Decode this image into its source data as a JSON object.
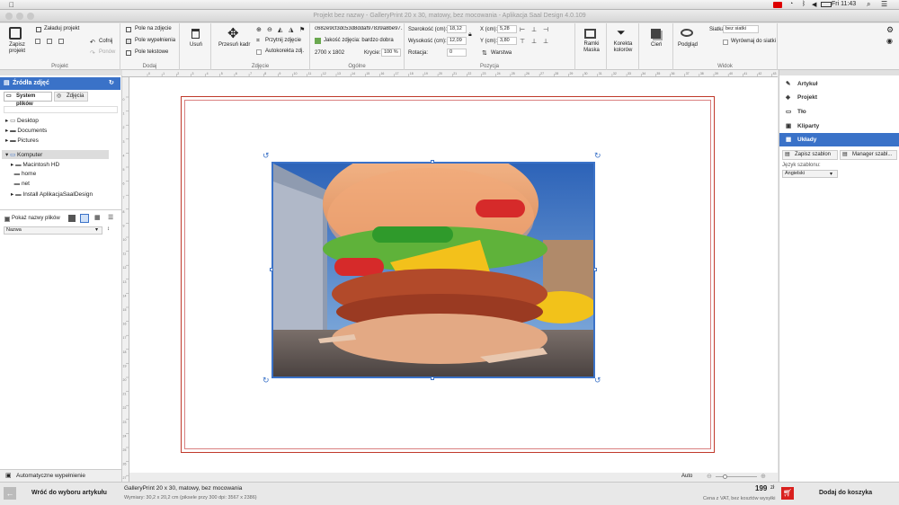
{
  "menubar": {
    "clock": "Fri 11:43"
  },
  "window": {
    "title": "Projekt bez nazwy - GalleryPrint 20 x 30, matowy, bez mocowania - Aplikacja Saal Design 4.0.109"
  },
  "ribbon": {
    "projekt": {
      "group_label": "Projekt",
      "save": "Zapisz projekt",
      "load": "Załaduj projekt",
      "undo": "Cofnij",
      "redo": "Ponów"
    },
    "dodaj": {
      "group_label": "Dodaj",
      "photo_field": "Pole na zdjęcie",
      "fill_field": "Pole wypełnienia",
      "text_field": "Pole tekstowe"
    },
    "usun": {
      "label": "Usuń"
    },
    "zdjecie": {
      "group_label": "Zdjęcie",
      "move_crop": "Przesuń kadr",
      "crop": "Przytnij zdjęcie",
      "autocorrect": "Autokorekta zdj."
    },
    "ogolne": {
      "group_label": "Ogólne",
      "filename": "c682e9cf3dc53d8ddaf97839a8be97...",
      "quality": "Jakość zdjęcia: bardzo dobra",
      "resolution": "2700 x 1802",
      "opacity_label": "Krycie:",
      "opacity_value": "100 %"
    },
    "pozycja": {
      "group_label": "Pozycja",
      "width_label": "Szerokość (cm):",
      "width_value": "18,12",
      "height_label": "Wysokość (cm):",
      "height_value": "12,09",
      "rotation_label": "Rotacja:",
      "rotation_value": "0",
      "x_label": "X (cm):",
      "x_value": "5,28",
      "y_label": "Y (cm):",
      "y_value": "3,80",
      "layer": "Warstwa"
    },
    "masks": {
      "frames": "Ramki Maska",
      "color": "Korekta kolorów",
      "shadow": "Cień"
    },
    "widok": {
      "group_label": "Widok",
      "preview": "Podgląd",
      "grid_label": "Siatka:",
      "grid_value": "bez siatki",
      "align": "Wyrównaj do siatki"
    }
  },
  "left_panel": {
    "header": "Źródła zdjęć",
    "tabs": [
      "System plików",
      "Zdjęcia"
    ],
    "tree": [
      "Desktop",
      "Documents",
      "Pictures",
      "Komputer",
      "Macintosh HD",
      "home",
      "net",
      "Install AplikacjaSaalDesign"
    ],
    "show_names": "Pokaż nazwy plików",
    "sort_value": "Nazwa",
    "autofill": "Automatyczne wypełnienie"
  },
  "right_panel": {
    "items": [
      "Artykuł",
      "Projekt",
      "Tło",
      "Kliparty",
      "Układy"
    ],
    "save_template": "Zapisz szablon",
    "template_manager": "Manager szabl...",
    "lang_label": "Język szablonu:",
    "lang_value": "Angielski"
  },
  "zoom": {
    "label": "Auto"
  },
  "ruler": {
    "h_ticks": [
      "0",
      "1",
      "2",
      "3",
      "4",
      "5",
      "6",
      "7",
      "8",
      "9",
      "10",
      "11",
      "12",
      "13",
      "14",
      "15",
      "16",
      "17",
      "18",
      "19",
      "20",
      "21",
      "22",
      "23",
      "24",
      "25",
      "26",
      "27",
      "28",
      "29",
      "30",
      "31",
      "32",
      "33",
      "34",
      "35",
      "36",
      "37",
      "38",
      "39",
      "40",
      "41",
      "42",
      "43"
    ],
    "v_ticks": [
      "0",
      "1",
      "2",
      "3",
      "4",
      "5",
      "6",
      "7",
      "8",
      "9",
      "10",
      "11",
      "12",
      "13",
      "14",
      "15",
      "16",
      "17",
      "18",
      "19",
      "20",
      "21",
      "22",
      "23",
      "24",
      "25",
      "26",
      "27"
    ]
  },
  "bottom": {
    "back": "Wróć do wyboru artykułu",
    "product": "GalleryPrint 20 x 30, matowy, bez mocowania",
    "dimensions": "Wymiary: 30,2 x 20,2 cm (piksele przy 300 dpi: 3567 x 2386)",
    "price": "199",
    "currency": "zł",
    "price_note": "Cena z VAT, bez kosztów wysyłki",
    "add_to_cart": "Dodaj do koszyka"
  },
  "colors": {
    "accent": "#3a72c8",
    "cart": "#d9201e",
    "border_red": "#c0392b"
  }
}
